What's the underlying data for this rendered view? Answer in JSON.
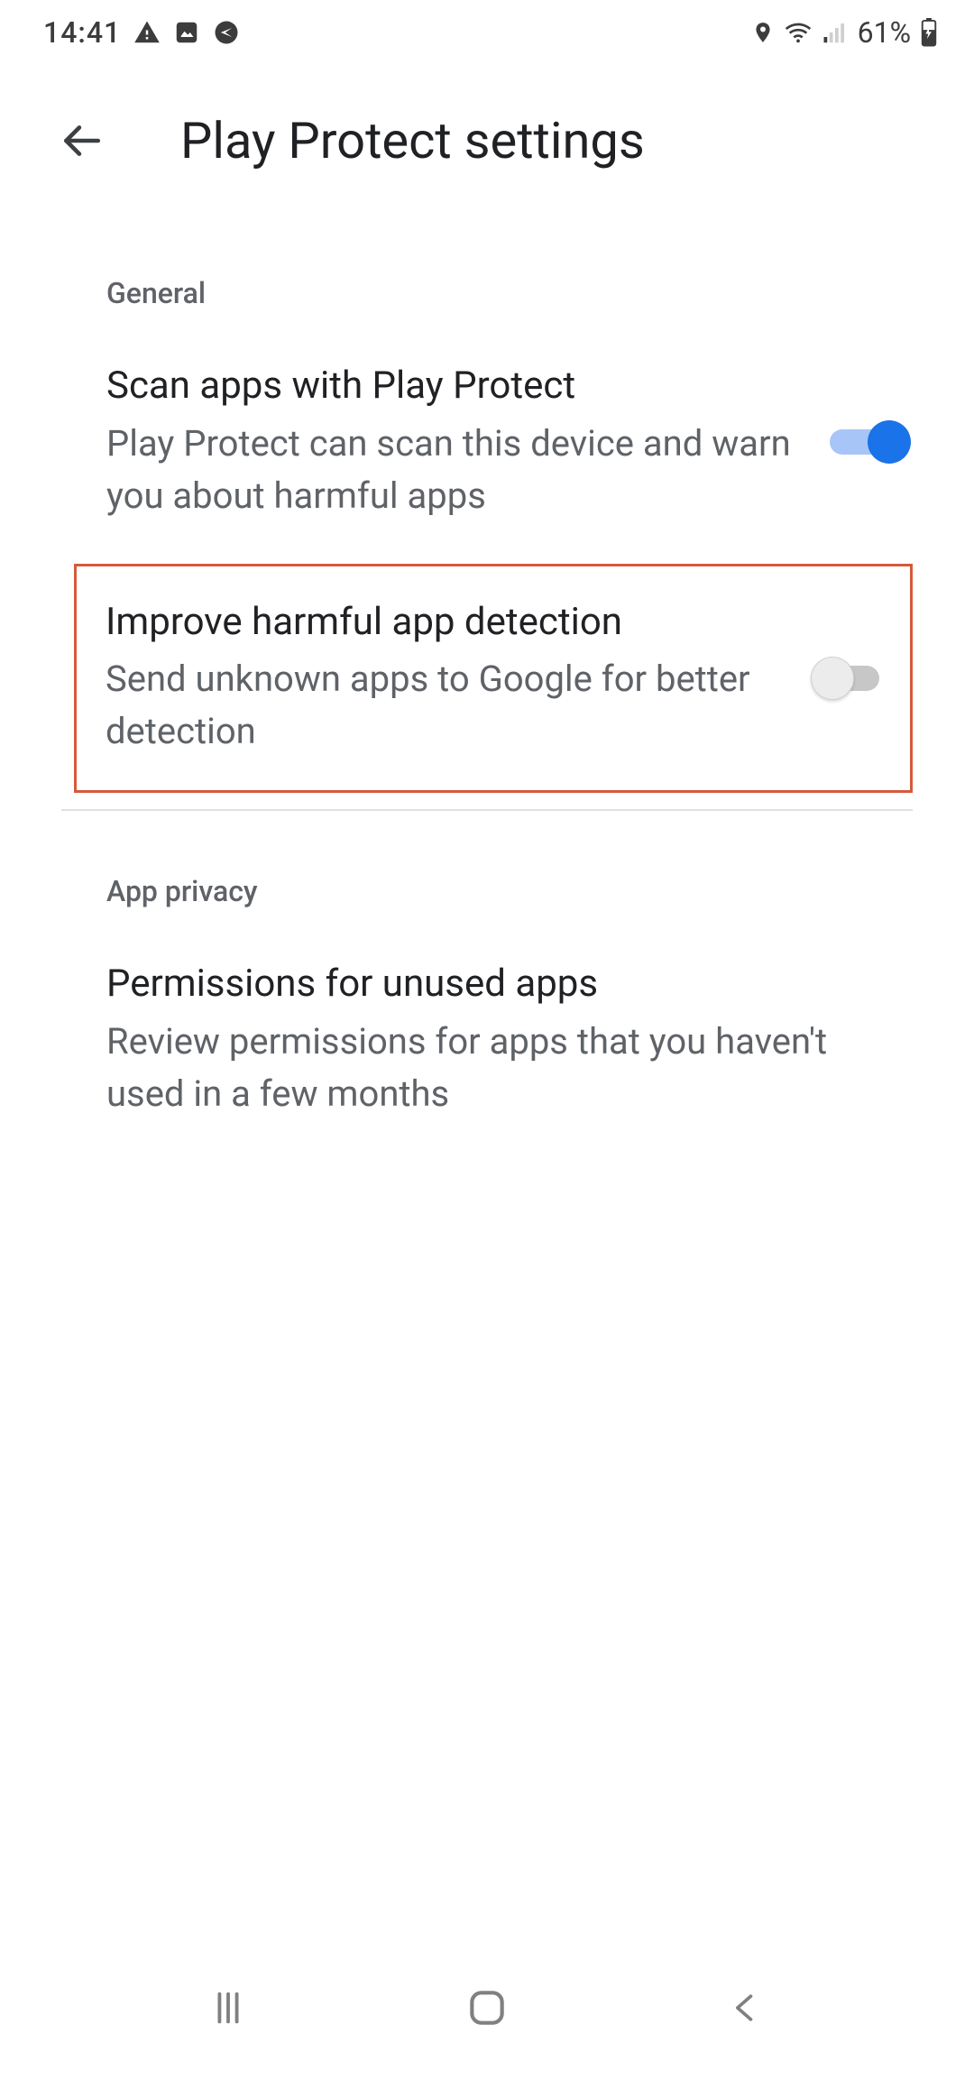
{
  "status": {
    "time": "14:41",
    "battery": "61%"
  },
  "header": {
    "title": "Play Protect settings"
  },
  "sections": {
    "general": {
      "label": "General",
      "scan": {
        "title": "Scan apps with Play Protect",
        "subtitle": "Play Protect can scan this device and warn you about harmful apps",
        "enabled": true
      },
      "improve": {
        "title": "Improve harmful app detection",
        "subtitle": "Send unknown apps to Google for better detection",
        "enabled": false
      }
    },
    "privacy": {
      "label": "App privacy",
      "permissions": {
        "title": "Permissions for unused apps",
        "subtitle": "Review permissions for apps that you haven't used in a few months"
      }
    }
  }
}
